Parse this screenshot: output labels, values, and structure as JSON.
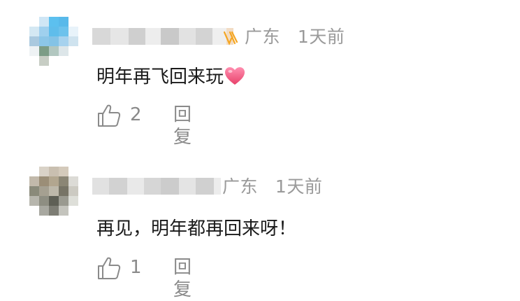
{
  "comments": [
    {
      "location": "广东",
      "time": "1天前",
      "text": "明年再飞回来玩",
      "likes": "2",
      "reply_label": "回复"
    },
    {
      "location": "广东",
      "time": "1天前",
      "text": "再见，明年都再回来呀！",
      "likes": "1",
      "reply_label": "回复"
    }
  ],
  "icons": [
    "vip-badge-icon",
    "heart-icon",
    "thumbs-up-icon"
  ],
  "colors": {
    "meta_text": "#9a9a9a",
    "body_text": "#1a1a1a",
    "badge": "#f5a623",
    "heart": "#e8416a"
  }
}
